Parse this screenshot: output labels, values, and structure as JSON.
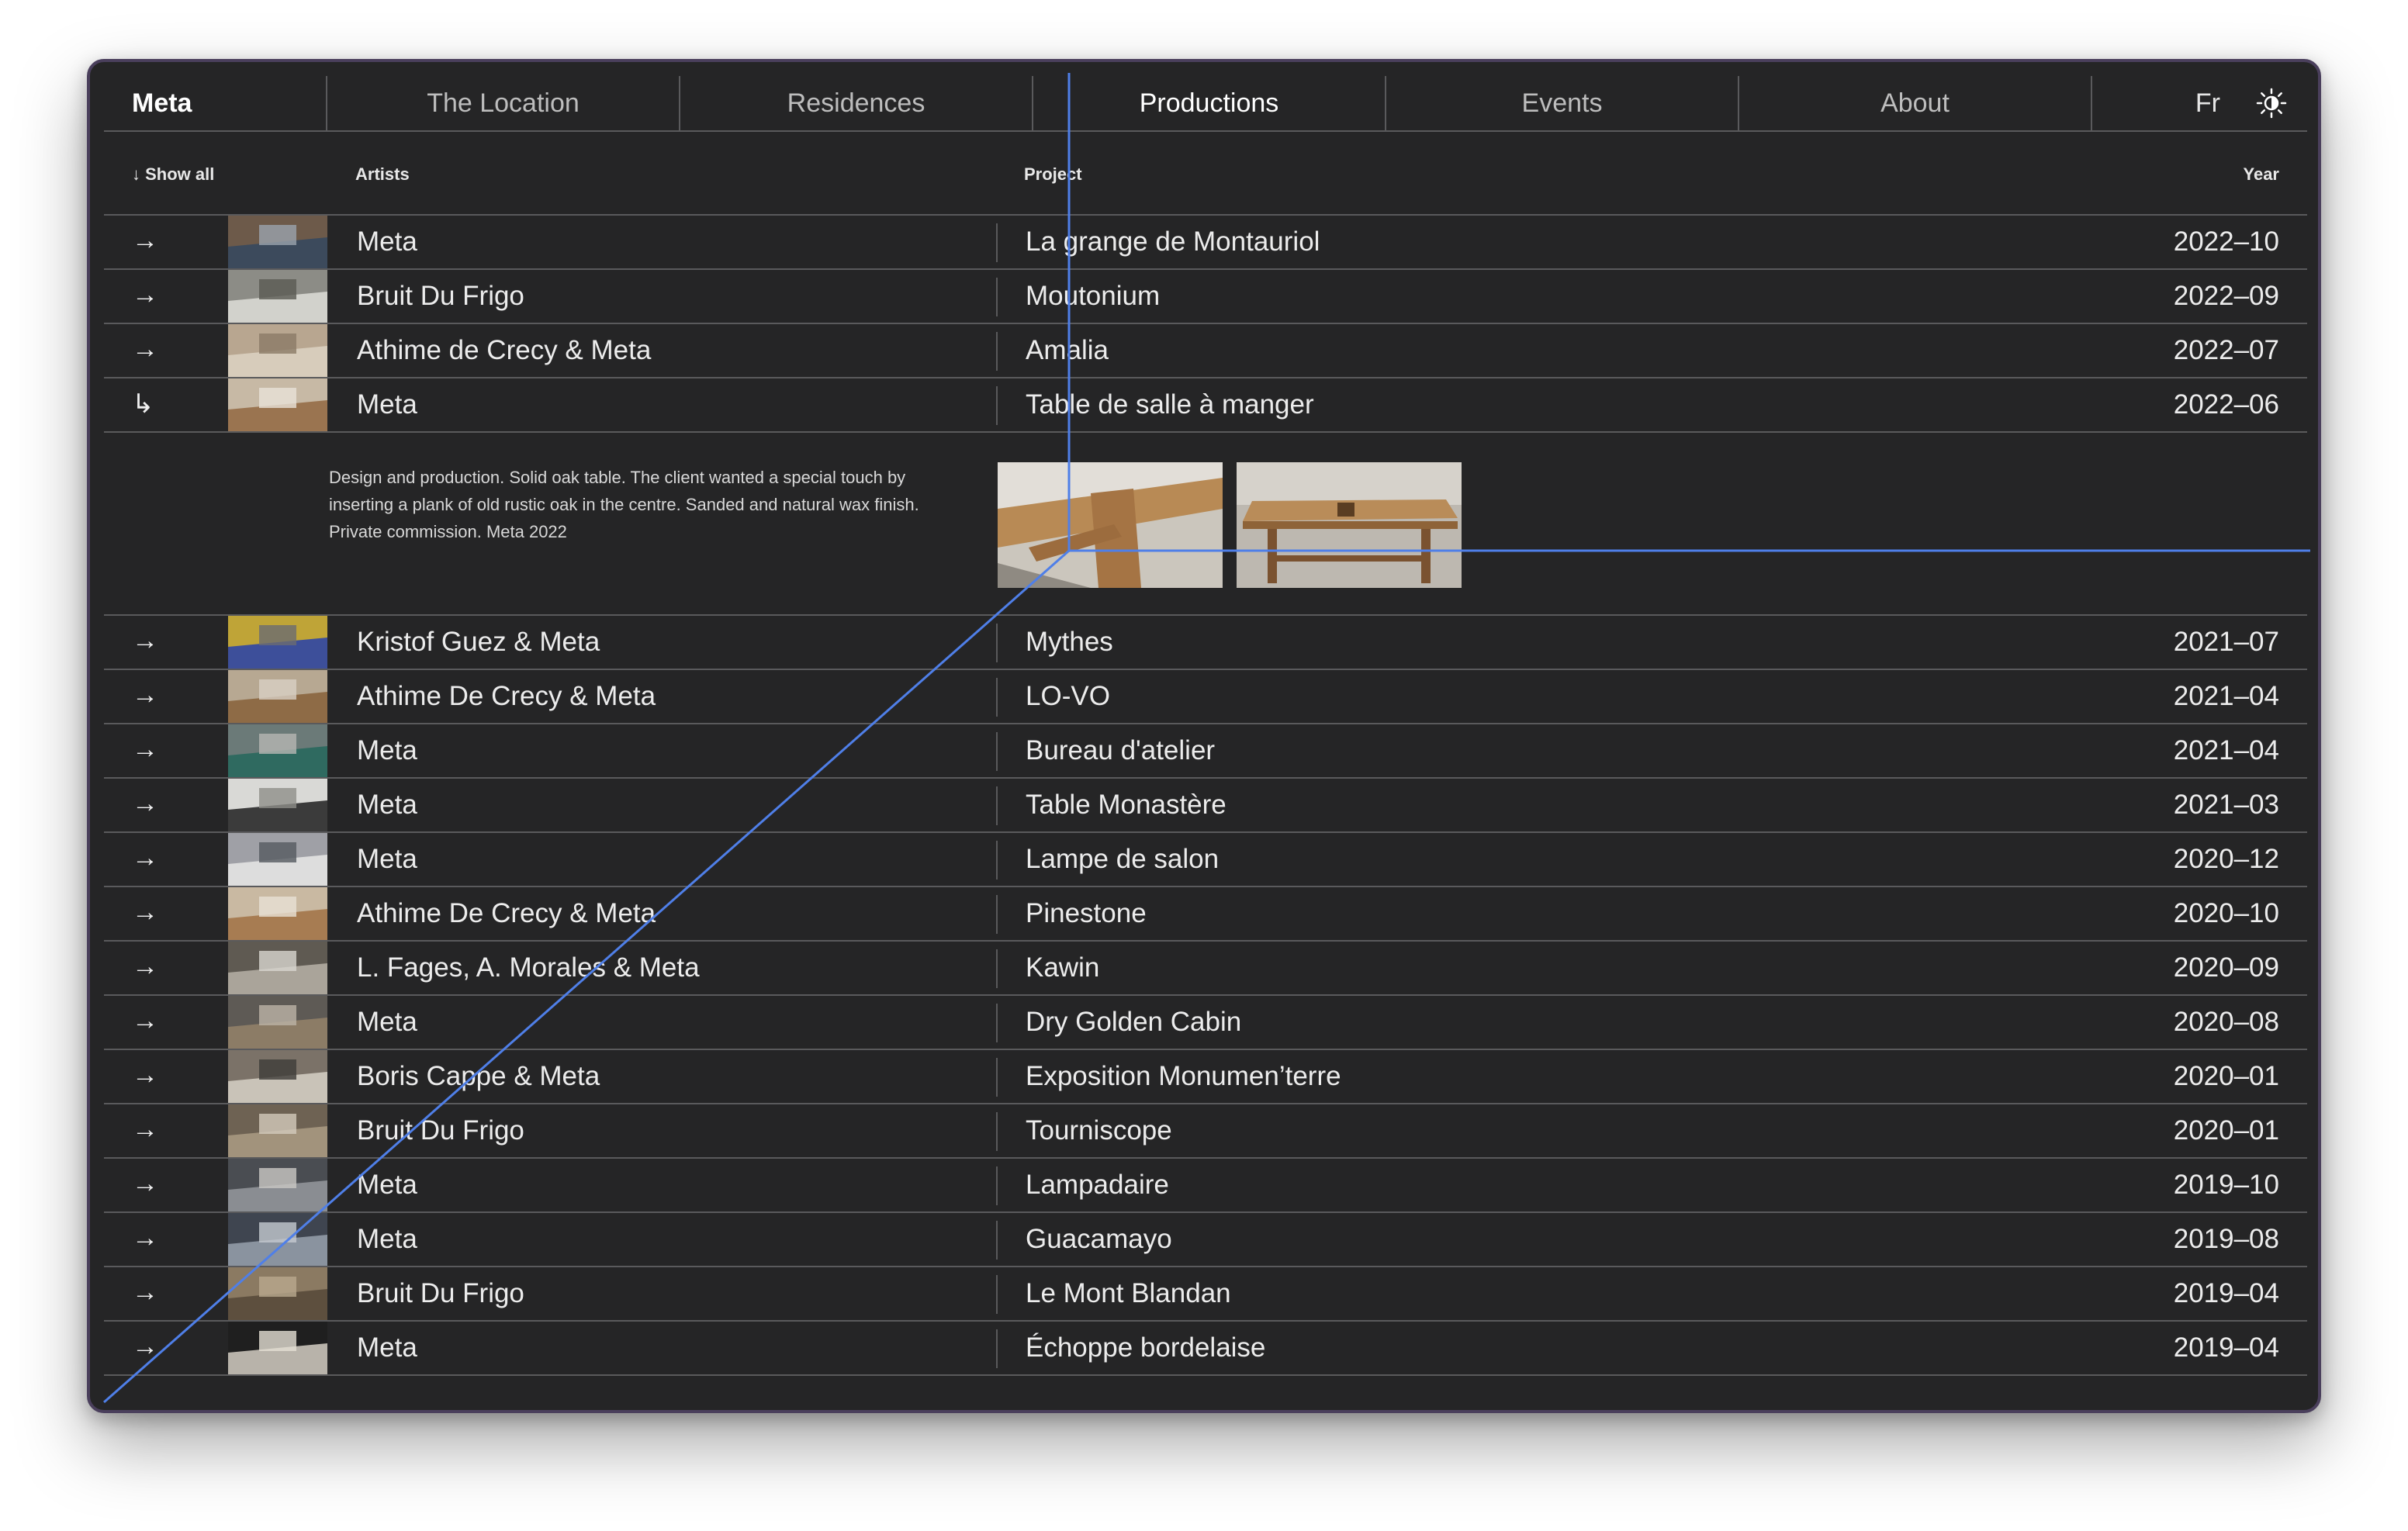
{
  "nav": {
    "brand": "Meta",
    "tabs": [
      "The Location",
      "Residences",
      "Productions",
      "Events",
      "About"
    ],
    "active_tab": "Productions",
    "lang": "Fr",
    "theme_icon": "sun-icon"
  },
  "table": {
    "show_all": "↓ Show all",
    "col_artists": "Artists",
    "col_project": "Project",
    "col_year": "Year"
  },
  "rows_before": [
    {
      "arrow": "→",
      "artist": "Meta",
      "project": "La grange de Montauriol",
      "year": "2022–10"
    },
    {
      "arrow": "→",
      "artist": "Bruit Du Frigo",
      "project": "Moutonium",
      "year": "2022–09"
    },
    {
      "arrow": "→",
      "artist": "Athime de Crecy & Meta",
      "project": "Amalia",
      "year": "2022–07"
    },
    {
      "arrow": "↳",
      "artist": "Meta",
      "project": "Table de salle à manger",
      "year": "2022–06"
    }
  ],
  "detail": {
    "description": "Design and production. Solid oak table. The client wanted a special touch by inserting a plank of old rustic oak in the centre. Sanded and natural wax finish. Private commission. Meta 2022"
  },
  "rows_after": [
    {
      "arrow": "→",
      "artist": "Kristof Guez & Meta",
      "project": "Mythes",
      "year": "2021–07"
    },
    {
      "arrow": "→",
      "artist": "Athime De Crecy & Meta",
      "project": "LO-VO",
      "year": "2021–04"
    },
    {
      "arrow": "→",
      "artist": "Meta",
      "project": "Bureau d'atelier",
      "year": "2021–04"
    },
    {
      "arrow": "→",
      "artist": "Meta",
      "project": "Table Monastère",
      "year": "2021–03"
    },
    {
      "arrow": "→",
      "artist": "Meta",
      "project": "Lampe de salon",
      "year": "2020–12"
    },
    {
      "arrow": "→",
      "artist": "Athime De Crecy & Meta",
      "project": "Pinestone",
      "year": "2020–10"
    },
    {
      "arrow": "→",
      "artist": "L. Fages, A. Morales & Meta",
      "project": "Kawin",
      "year": "2020–09"
    },
    {
      "arrow": "→",
      "artist": "Meta",
      "project": "Dry Golden Cabin",
      "year": "2020–08"
    },
    {
      "arrow": "→",
      "artist": "Boris Cappe & Meta",
      "project": "Exposition Monumen’terre",
      "year": "2020–01"
    },
    {
      "arrow": "→",
      "artist": "Bruit Du Frigo",
      "project": "Tourniscope",
      "year": "2020–01"
    },
    {
      "arrow": "→",
      "artist": "Meta",
      "project": "Lampadaire",
      "year": "2019–10"
    },
    {
      "arrow": "→",
      "artist": "Meta",
      "project": "Guacamayo",
      "year": "2019–08"
    },
    {
      "arrow": "→",
      "artist": "Bruit Du Frigo",
      "project": "Le Mont Blandan",
      "year": "2019–04"
    },
    {
      "arrow": "→",
      "artist": "Meta",
      "project": "Échoppe bordelaise",
      "year": "2019–04"
    }
  ],
  "colors": {
    "background": "#252526",
    "line": "#5a5a5c",
    "overlay_line": "#4f7fe8"
  }
}
